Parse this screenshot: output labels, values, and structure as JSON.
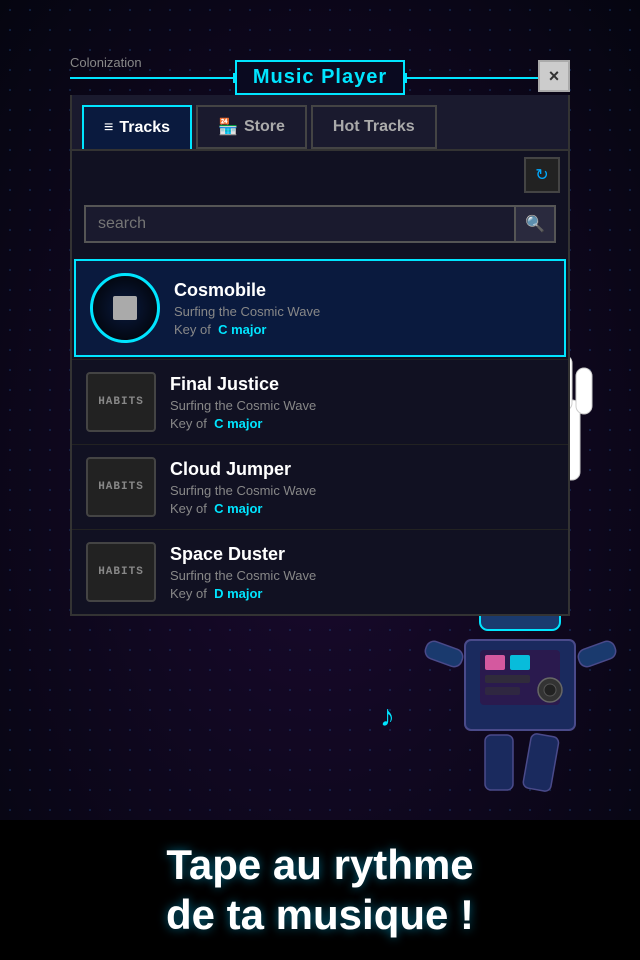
{
  "app": {
    "title": "Music Player",
    "colonization_label": "Colonization",
    "close_label": "×"
  },
  "tabs": [
    {
      "id": "tracks",
      "label": "Tracks",
      "icon": "≡",
      "active": true
    },
    {
      "id": "store",
      "label": "Store",
      "icon": "🏪",
      "active": false
    },
    {
      "id": "hot_tracks",
      "label": "Hot Tracks",
      "active": false
    }
  ],
  "search": {
    "placeholder": "search"
  },
  "tracks": [
    {
      "id": 1,
      "name": "Cosmobile",
      "subtitle": "Surfing the Cosmic Wave",
      "key_label": "Key of",
      "key_value": "C major",
      "active": true,
      "thumb_type": "player"
    },
    {
      "id": 2,
      "name": "Final Justice",
      "subtitle": "Surfing the Cosmic Wave",
      "key_label": "Key of",
      "key_value": "C major",
      "active": false,
      "thumb_type": "habits"
    },
    {
      "id": 3,
      "name": "Cloud Jumper",
      "subtitle": "Surfing the Cosmic Wave",
      "key_label": "Key of",
      "key_value": "C major",
      "active": false,
      "thumb_type": "habits"
    },
    {
      "id": 4,
      "name": "Space Duster",
      "subtitle": "Surfing the Cosmic Wave",
      "key_label": "Key of",
      "key_value": "D major",
      "active": false,
      "thumb_type": "habits"
    }
  ],
  "bottom_tagline": "Tape au rythme\nde ta musique !",
  "colors": {
    "accent": "#00e5ff",
    "bg_dark": "#111122",
    "text_white": "#ffffff"
  }
}
